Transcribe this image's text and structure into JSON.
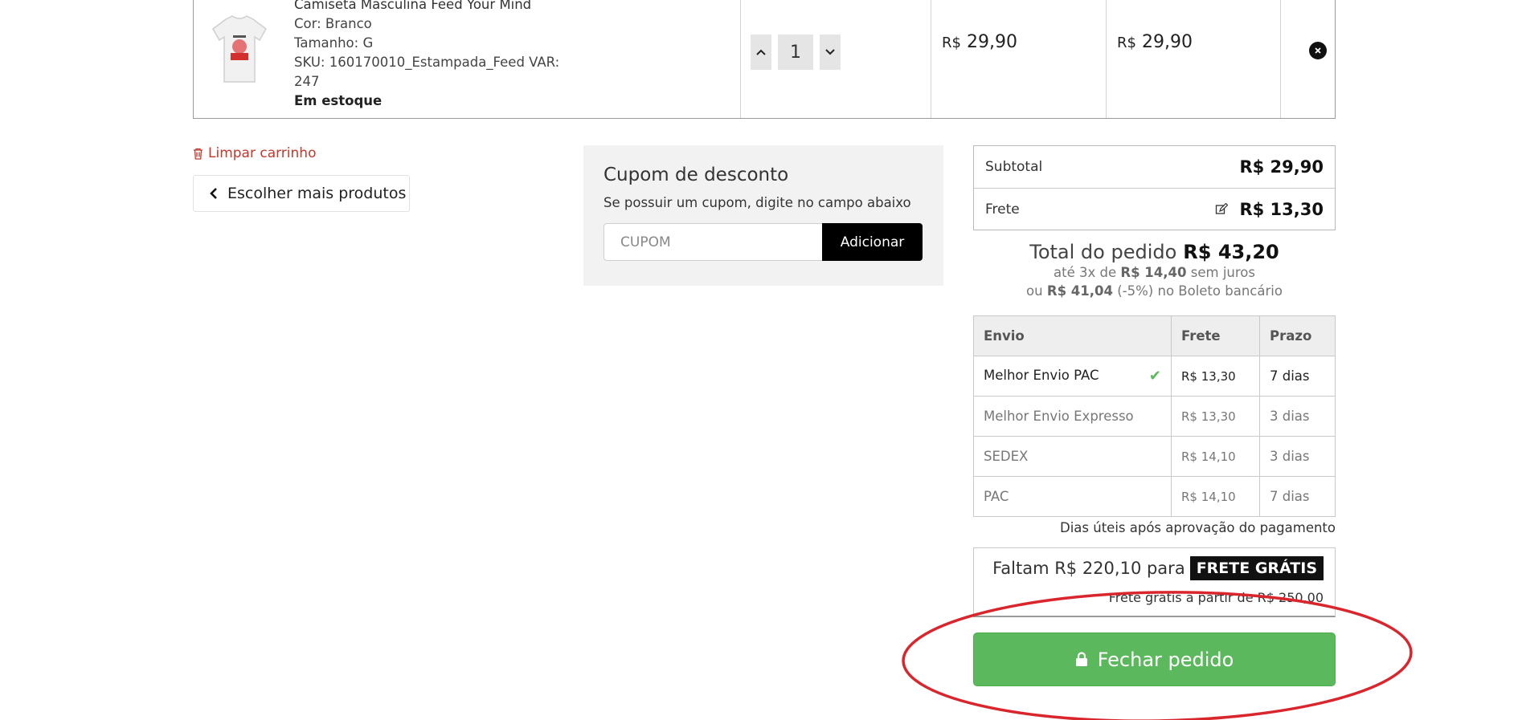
{
  "cart_item": {
    "name": "Camiseta Masculina Feed Your Mind",
    "color": "Cor: Branco",
    "size": "Tamanho: G",
    "sku": "SKU: 160170010_Estampada_Feed VAR: 247",
    "stock": "Em estoque",
    "quantity": "1",
    "unit_price_currency": "R$",
    "unit_price": "29,90",
    "total_price_currency": "R$",
    "total_price": "29,90"
  },
  "actions": {
    "clear_cart": "Limpar carrinho",
    "continue_shopping": "Escolher mais produtos"
  },
  "coupon": {
    "title": "Cupom de desconto",
    "hint": "Se possuir um cupom, digite no campo abaixo",
    "placeholder": "CUPOM",
    "button": "Adicionar"
  },
  "summary": {
    "subtotal_label": "Subtotal",
    "subtotal_value": "R$ 29,90",
    "shipping_label": "Frete",
    "shipping_value": "R$ 13,30"
  },
  "total": {
    "label": "Total do pedido",
    "value": "R$ 43,20",
    "installments_prefix": "até 3x de",
    "installments_value": "R$ 14,40",
    "installments_suffix": "sem juros",
    "boleto_prefix": "ou",
    "boleto_value": "R$ 41,04",
    "boleto_suffix": "(-5%) no Boleto bancário"
  },
  "shipping_table": {
    "headers": [
      "Envio",
      "Frete",
      "Prazo"
    ],
    "rows": [
      {
        "method": "Melhor Envio PAC",
        "price": "R$ 13,30",
        "time": "7 dias",
        "selected": true
      },
      {
        "method": "Melhor Envio Expresso",
        "price": "R$ 13,30",
        "time": "3 dias",
        "selected": false
      },
      {
        "method": "SEDEX",
        "price": "R$ 14,10",
        "time": "3 dias",
        "selected": false
      },
      {
        "method": "PAC",
        "price": "R$ 14,10",
        "time": "7 dias",
        "selected": false
      }
    ],
    "note": "Dias úteis após aprovação do pagamento"
  },
  "free_shipping": {
    "remaining_text": "Faltam R$ 220,10 para",
    "badge": "FRETE GRÁTIS",
    "threshold_text": "Frete grátis a partir de R$ 250,00"
  },
  "checkout": {
    "label": "Fechar pedido"
  },
  "colors": {
    "checkout_green": "#5cb85c",
    "clear_cart_red": "#c0392b",
    "annotation_red": "#d9262c"
  }
}
